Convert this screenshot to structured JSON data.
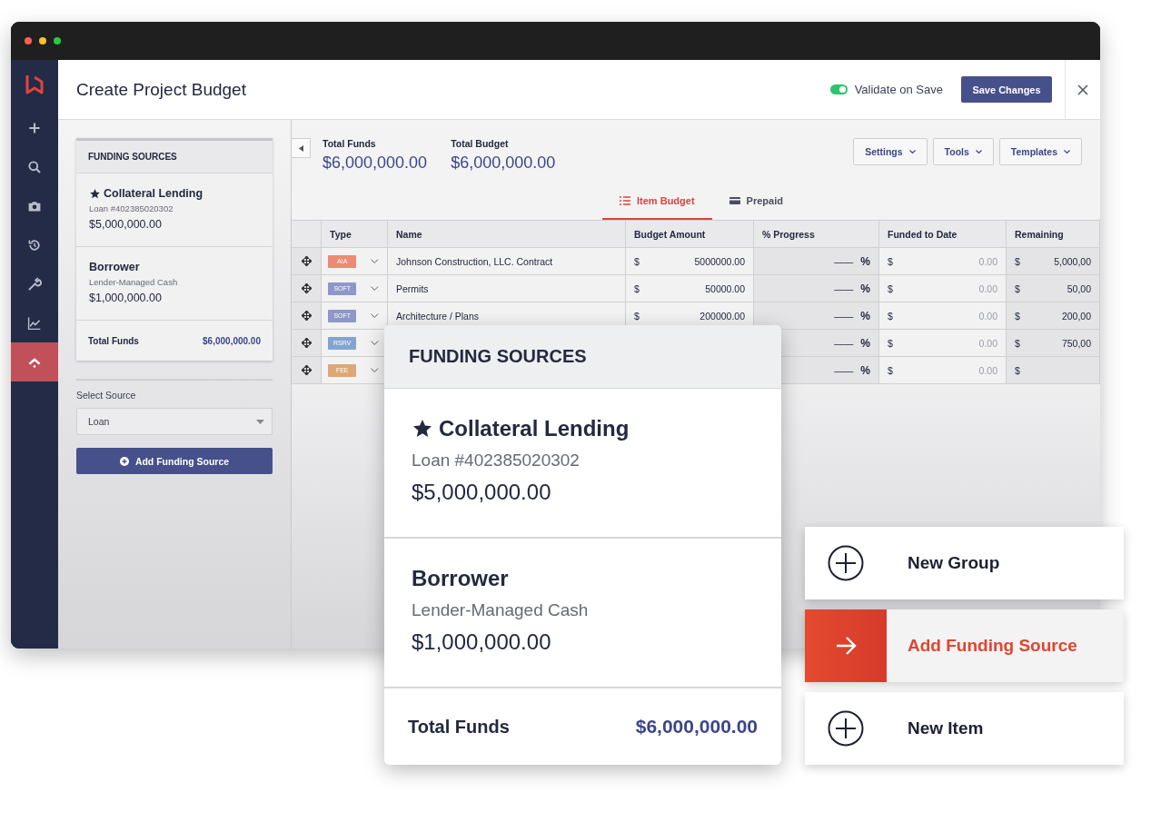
{
  "window": {
    "title": "Create Project Budget"
  },
  "sidebar": {
    "items": [
      {
        "selected": false
      },
      {
        "selected": false
      },
      {
        "selected": false
      },
      {
        "selected": false
      },
      {
        "selected": false
      },
      {
        "selected": false
      },
      {
        "selected": true
      }
    ]
  },
  "header": {
    "validate": {
      "label": "Validate on Save",
      "on": true
    },
    "save_button": "Save Changes"
  },
  "funding_panel": {
    "title": "FUNDING SOURCES",
    "sources": [
      {
        "name": "Collateral Lending",
        "starred": true,
        "detail": "Loan #402385020302",
        "amount": "$5,000,000.00"
      },
      {
        "name": "Borrower",
        "starred": false,
        "detail": "Lender-Managed Cash",
        "amount": "$1,000,000.00"
      }
    ],
    "total_label": "Total Funds",
    "total": "$6,000,000.00",
    "select_label": "Select Source",
    "select_value": "Loan",
    "add_button": "Add Funding Source"
  },
  "summary": [
    {
      "label": "Total Funds",
      "value": "$6,000,000.00"
    },
    {
      "label": "Total Budget",
      "value": "$6,000,000.00"
    }
  ],
  "menus": [
    "Settings",
    "Tools",
    "Templates"
  ],
  "tabs": [
    {
      "label": "Item Budget",
      "kind": "list",
      "selected": true
    },
    {
      "label": "Prepaid",
      "kind": "card",
      "selected": false
    }
  ],
  "table": {
    "columns": [
      "Type",
      "Name",
      "Budget Amount",
      "% Progress",
      "Funded to Date",
      "Remaining"
    ],
    "rows": [
      {
        "type": "AIA",
        "color": "#ec8a73",
        "name": "Johnson Construction, LLC. Contract",
        "budget_symbol": "$",
        "budget": "5000000.00",
        "progress": "——",
        "percent": "%",
        "funded_symbol": "$",
        "funded": "0.00",
        "remaining_symbol": "$",
        "remaining": "5,000,00"
      },
      {
        "type": "SOFT",
        "color": "#8f97c9",
        "name": "Permits",
        "budget_symbol": "$",
        "budget": "50000.00",
        "progress": "——",
        "percent": "%",
        "funded_symbol": "$",
        "funded": "0.00",
        "remaining_symbol": "$",
        "remaining": "50,00"
      },
      {
        "type": "SOFT",
        "color": "#8f97c9",
        "name": "Architecture / Plans",
        "budget_symbol": "$",
        "budget": "200000.00",
        "progress": "——",
        "percent": "%",
        "funded_symbol": "$",
        "funded": "0.00",
        "remaining_symbol": "$",
        "remaining": "200,00"
      },
      {
        "type": "RSRV",
        "color": "#84a3cf",
        "progress": "——",
        "percent": "%",
        "funded_symbol": "$",
        "funded": "0.00",
        "remaining_symbol": "$",
        "remaining": "750,00"
      },
      {
        "type": "FEE",
        "color": "#dba878",
        "progress": "——",
        "percent": "%",
        "funded_symbol": "$",
        "funded": "0.00",
        "remaining_symbol": "$"
      }
    ]
  },
  "zoom_card": {
    "title": "FUNDING SOURCES",
    "sources": [
      {
        "name": "Collateral Lending",
        "starred": true,
        "detail": "Loan #402385020302",
        "amount": "$5,000,000.00"
      },
      {
        "name": "Borrower",
        "starred": false,
        "detail": "Lender-Managed Cash",
        "amount": "$1,000,000.00"
      }
    ],
    "total_label": "Total Funds",
    "total": "$6,000,000.00"
  },
  "actions": [
    {
      "label": "New Group",
      "kind": "add",
      "selected": false
    },
    {
      "label": "Add Funding Source",
      "kind": "go",
      "selected": true
    },
    {
      "label": "New Item",
      "kind": "add",
      "selected": false
    }
  ]
}
